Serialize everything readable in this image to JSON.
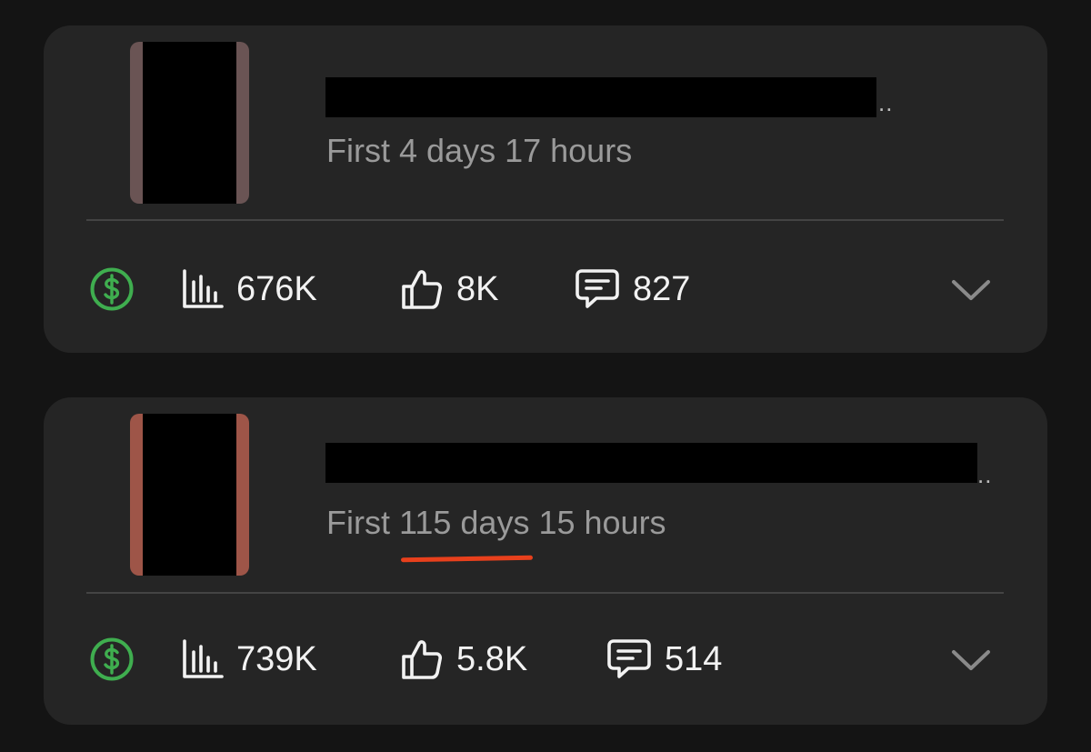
{
  "colors": {
    "background": "#141414",
    "card": "#252525",
    "money_green": "#3fae4f",
    "underline_red": "#e8401c",
    "thumb_border_1": "#6a5454",
    "thumb_border_2": "#9e5548"
  },
  "posts": [
    {
      "title_ellipsis": "..",
      "subtitle_prefix": "First",
      "subtitle_days": "4 days",
      "subtitle_hours": "17 hours",
      "views": "676K",
      "likes": "8K",
      "comments": "827",
      "icons": [
        "monetization-dollar-icon",
        "views-bar-chart-icon",
        "thumbs-up-icon",
        "comment-icon",
        "chevron-down-icon"
      ]
    },
    {
      "title_ellipsis": "..",
      "subtitle_prefix": "First",
      "subtitle_days": "115 days",
      "subtitle_hours": "15 hours",
      "views": "739K",
      "likes": "5.8K",
      "comments": "514",
      "icons": [
        "monetization-dollar-icon",
        "views-bar-chart-icon",
        "thumbs-up-icon",
        "comment-icon",
        "chevron-down-icon"
      ]
    }
  ]
}
